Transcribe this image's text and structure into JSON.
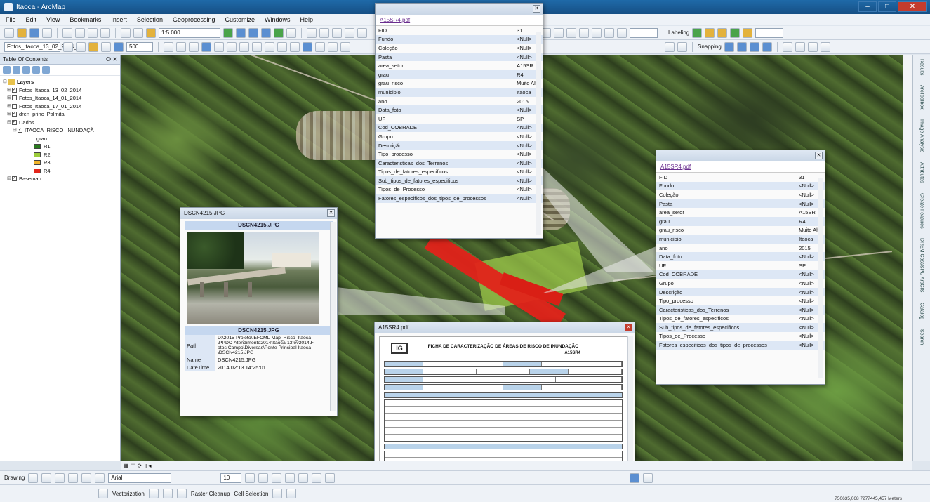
{
  "window": {
    "title": "Itaoca - ArcMap"
  },
  "menu": [
    "File",
    "Edit",
    "View",
    "Bookmarks",
    "Insert",
    "Selection",
    "Geoprocessing",
    "Customize",
    "Windows",
    "Help"
  ],
  "toolbar": {
    "scale": "1:5.000",
    "layer_combo": "Fotos_Itaoca_13_02_2014_",
    "zoom_value": "500",
    "labeling": "Labeling",
    "snapping": "Snapping",
    "font_combo": "Arial",
    "font_size": "10",
    "drawing": "Drawing",
    "vectorization": "Vectorization",
    "raster_cleanup": "Raster Cleanup",
    "cell_selection": "Cell Selection"
  },
  "toc": {
    "title": "Table Of Contents",
    "root": "Layers",
    "layers": [
      "Fotos_Itaoca_13_02_2014_",
      "Fotos_Itaoca_14_01_2014",
      "Fotos_Itaoca_17_01_2014",
      "dren_princ_Palmital",
      "Dados",
      "ITAOCA_RISCO_INUNDAÇÃ"
    ],
    "legend_field": "grau",
    "legend": [
      {
        "label": "R1",
        "color": "#2a7a1f"
      },
      {
        "label": "R2",
        "color": "#9ccc3a"
      },
      {
        "label": "R3",
        "color": "#f0b429"
      },
      {
        "label": "R4",
        "color": "#e3251b"
      }
    ],
    "basemap": "Basemap"
  },
  "attr_top": {
    "file": "A15SR4.pdf",
    "rows": [
      [
        "FID",
        "31"
      ],
      [
        "Fundo",
        "<Null>"
      ],
      [
        "Coleção",
        "<Null>"
      ],
      [
        "Pasta",
        "<Null>"
      ],
      [
        "area_setor",
        "A15SR"
      ],
      [
        "grau",
        "R4"
      ],
      [
        "grau_risco",
        "Muito Alto"
      ],
      [
        "municipio",
        "Itaoca"
      ],
      [
        "ano",
        "2015"
      ],
      [
        "Data_foto",
        "<Null>"
      ],
      [
        "UF",
        "SP"
      ],
      [
        "Cod_COBRADE",
        "<Null>"
      ],
      [
        "Grupo",
        "<Null>"
      ],
      [
        "Descrição",
        "<Null>"
      ],
      [
        "Tipo_processo",
        "<Null>"
      ],
      [
        "Caracteristicas_dos_Terrenos",
        "<Null>"
      ],
      [
        "Tipos_de_fatores_especificos",
        "<Null>"
      ],
      [
        "Sub_tipos_de_fatores_especificos",
        "<Null>"
      ],
      [
        "Tipos_de_Processo",
        "<Null>"
      ],
      [
        "Fatores_especificos_dos_tipos_de_processos",
        "<Null>"
      ]
    ]
  },
  "attr_right": {
    "file": "A15SR4.pdf",
    "rows": [
      [
        "FID",
        "31"
      ],
      [
        "Fundo",
        "<Null>"
      ],
      [
        "Coleção",
        "<Null>"
      ],
      [
        "Pasta",
        "<Null>"
      ],
      [
        "area_setor",
        "A15SR"
      ],
      [
        "grau",
        "R4"
      ],
      [
        "grau_risco",
        "Muito Alto"
      ],
      [
        "municipio",
        "Itaoca"
      ],
      [
        "ano",
        "2015"
      ],
      [
        "Data_foto",
        "<Null>"
      ],
      [
        "UF",
        "SP"
      ],
      [
        "Cod_COBRADE",
        "<Null>"
      ],
      [
        "Grupo",
        "<Null>"
      ],
      [
        "Descrição",
        "<Null>"
      ],
      [
        "Tipo_processo",
        "<Null>"
      ],
      [
        "Caracteristicas_dos_Terrenos",
        "<Null>"
      ],
      [
        "Tipos_de_fatores_especificos",
        "<Null>"
      ],
      [
        "Sub_tipos_de_fatores_especificos",
        "<Null>"
      ],
      [
        "Tipos_de_Processo",
        "<Null>"
      ],
      [
        "Fatores_especificos_dos_tipos_de_processos",
        "<Null>"
      ]
    ]
  },
  "photo_popup": {
    "window_title": "DSCN4215.JPG",
    "header": "DSCN4215.JPG",
    "caption": "DSCN4215.JPG",
    "path_label": "Path",
    "path_value": "D:\\2015-Projeto\\IEFCML-Map_Risco_Itaoca\\PPDC-Atendimento2014\\Itaoca-13fev2014\\Fotos Campo\\Diversas\\Ponte Principal Itaoca\\DSCN4215.JPG",
    "name_label": "Name",
    "name_value": "DSCN4215.JPG",
    "datetime_label": "DateTime",
    "datetime_value": "2014:02:13 14:25:01"
  },
  "pdf_popup": {
    "window_title": "A15SR4.pdf",
    "logo": "IG",
    "form_title": "FICHA DE CARACTERIZAÇÃO DE ÁREAS DE RISCO DE INUNDAÇÃO",
    "setor_code": "A15SR4"
  },
  "dock": [
    "Results",
    "ArcToolbox",
    "Image Analysis",
    "Attributes",
    "Create Features",
    "DREM Cost/SPU ArcGIS",
    "Catalog",
    "Search"
  ],
  "status_coords": "750635,068  7277445,457 Meters"
}
